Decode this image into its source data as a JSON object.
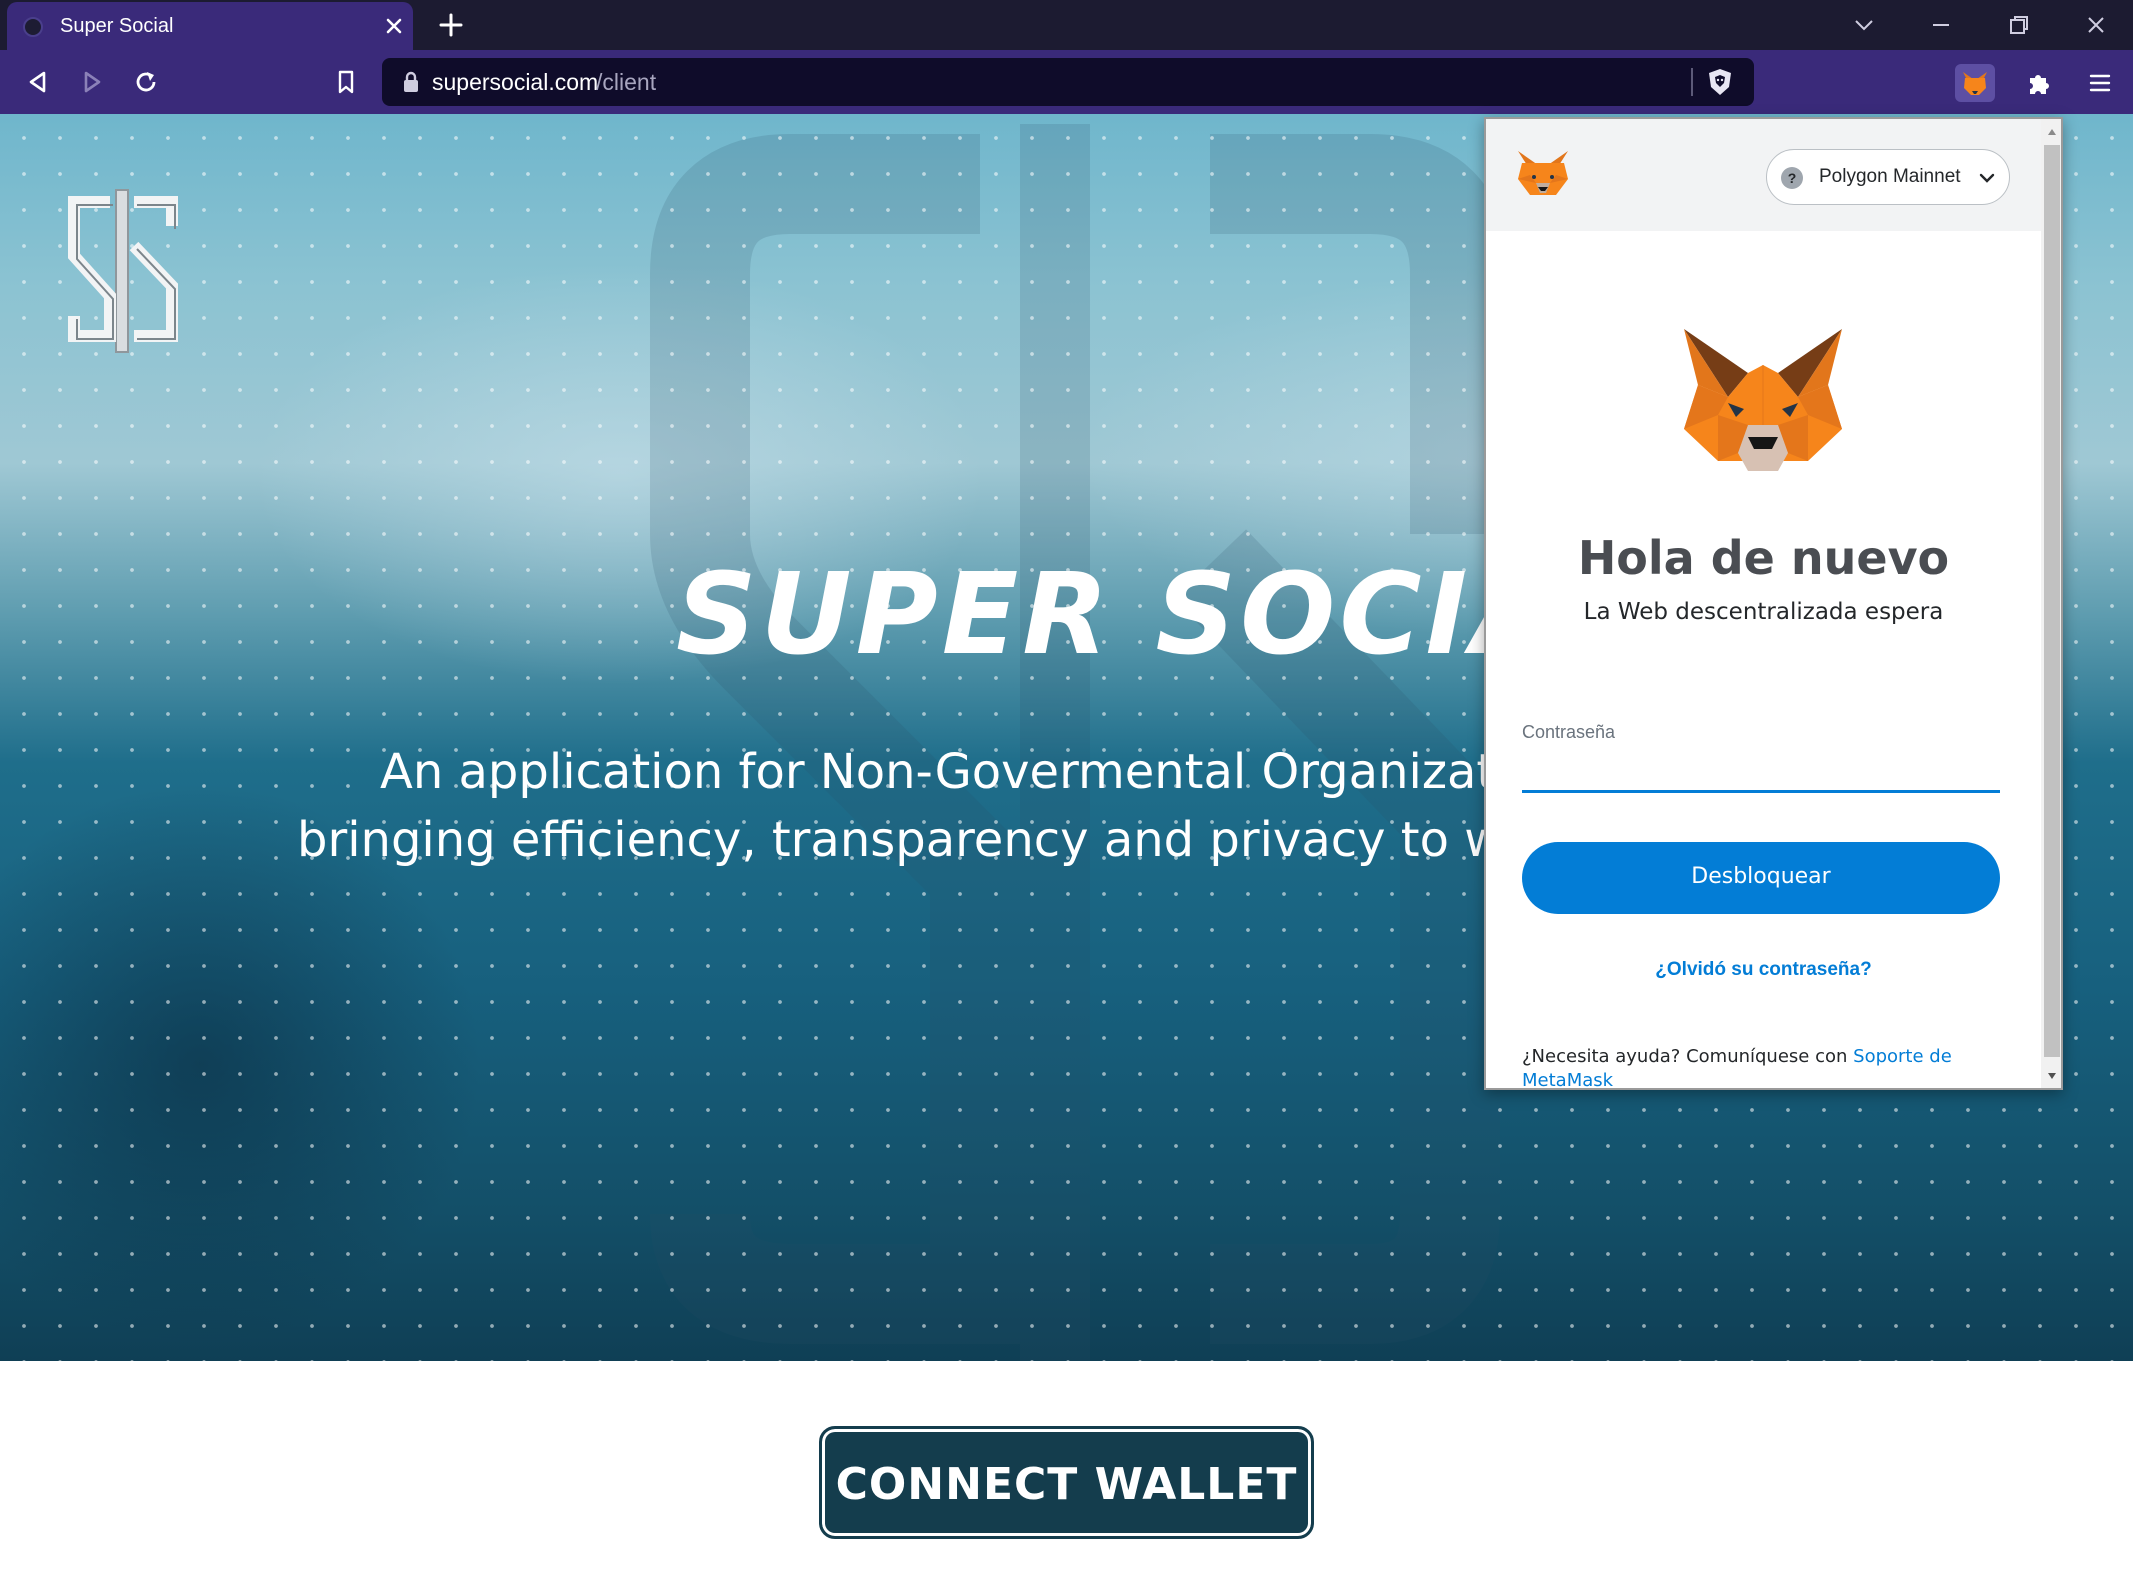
{
  "browser": {
    "tab_title": "Super Social",
    "url_host": "supersocial.com",
    "url_path": "/client"
  },
  "page": {
    "hero_title": "SUPER SOCIAL",
    "hero_subtitle_line1": "An application for Non-Govermental Organizatio",
    "hero_subtitle_line2": "bringing efficiency, transparency and privacy to we",
    "connect_wallet_label": "CONNECT WALLET"
  },
  "metamask": {
    "network_label": "Polygon Mainnet",
    "network_status_glyph": "?",
    "title": "Hola de nuevo",
    "subtitle": "La Web descentralizada espera",
    "password_label": "Contraseña",
    "unlock_label": "Desbloquear",
    "forgot_password": "¿Olvidó su contraseña?",
    "help_text": "¿Necesita ayuda? Comuníquese con ",
    "help_link": "Soporte de MetaMask"
  },
  "colors": {
    "browser_frame": "#3a2a7a",
    "tabstrip": "#1c1b31",
    "hero_dark": "#134f68",
    "hero_light": "#9fc8d4",
    "connect_button": "#143d4d",
    "metamask_blue": "#037dd6",
    "fox_orange": "#f6851b"
  },
  "icons": {
    "tab_favicon": "circle-favicon-icon",
    "tab_close": "close-icon",
    "new_tab": "plus-icon",
    "back": "back-triangle-icon",
    "forward": "forward-triangle-icon",
    "reload": "reload-icon",
    "bookmark": "bookmark-icon",
    "lock": "lock-icon",
    "brave_shield": "brave-lion-shield-icon",
    "metamask_extension": "metamask-fox-icon",
    "extensions": "puzzle-piece-icon",
    "menu": "hamburger-menu-icon"
  }
}
